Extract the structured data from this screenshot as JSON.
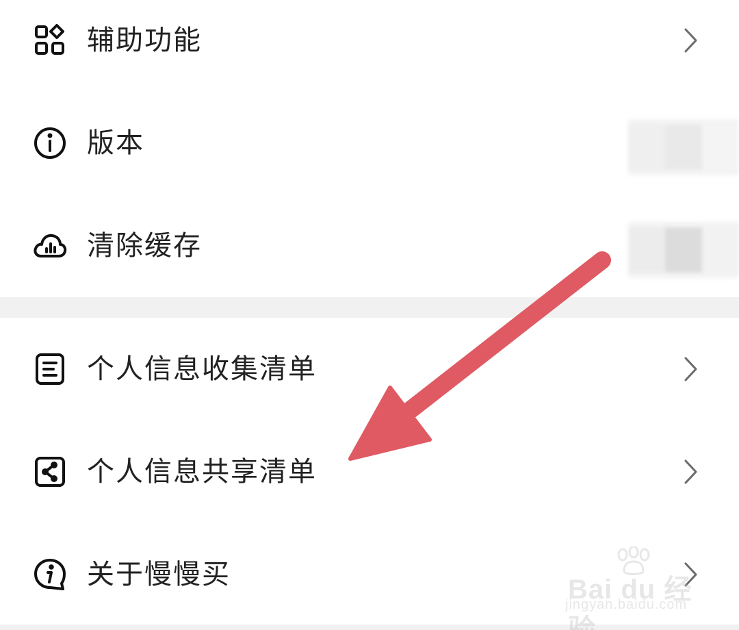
{
  "settings": {
    "items": [
      {
        "label": "辅助功能",
        "icon": "apps-grid-icon",
        "has_chevron": true
      },
      {
        "label": "版本",
        "icon": "info-circle-icon",
        "has_chevron": false
      },
      {
        "label": "清除缓存",
        "icon": "cloud-chart-icon",
        "has_chevron": false
      },
      {
        "label": "个人信息收集清单",
        "icon": "document-list-icon",
        "has_chevron": true
      },
      {
        "label": "个人信息共享清单",
        "icon": "share-box-icon",
        "has_chevron": true
      },
      {
        "label": "关于慢慢买",
        "icon": "info-bubble-icon",
        "has_chevron": true
      }
    ]
  },
  "annotation": {
    "color": "#df5a63"
  },
  "watermark": {
    "main": "Bai du 经验",
    "sub": "jingyan.baidu.com"
  }
}
